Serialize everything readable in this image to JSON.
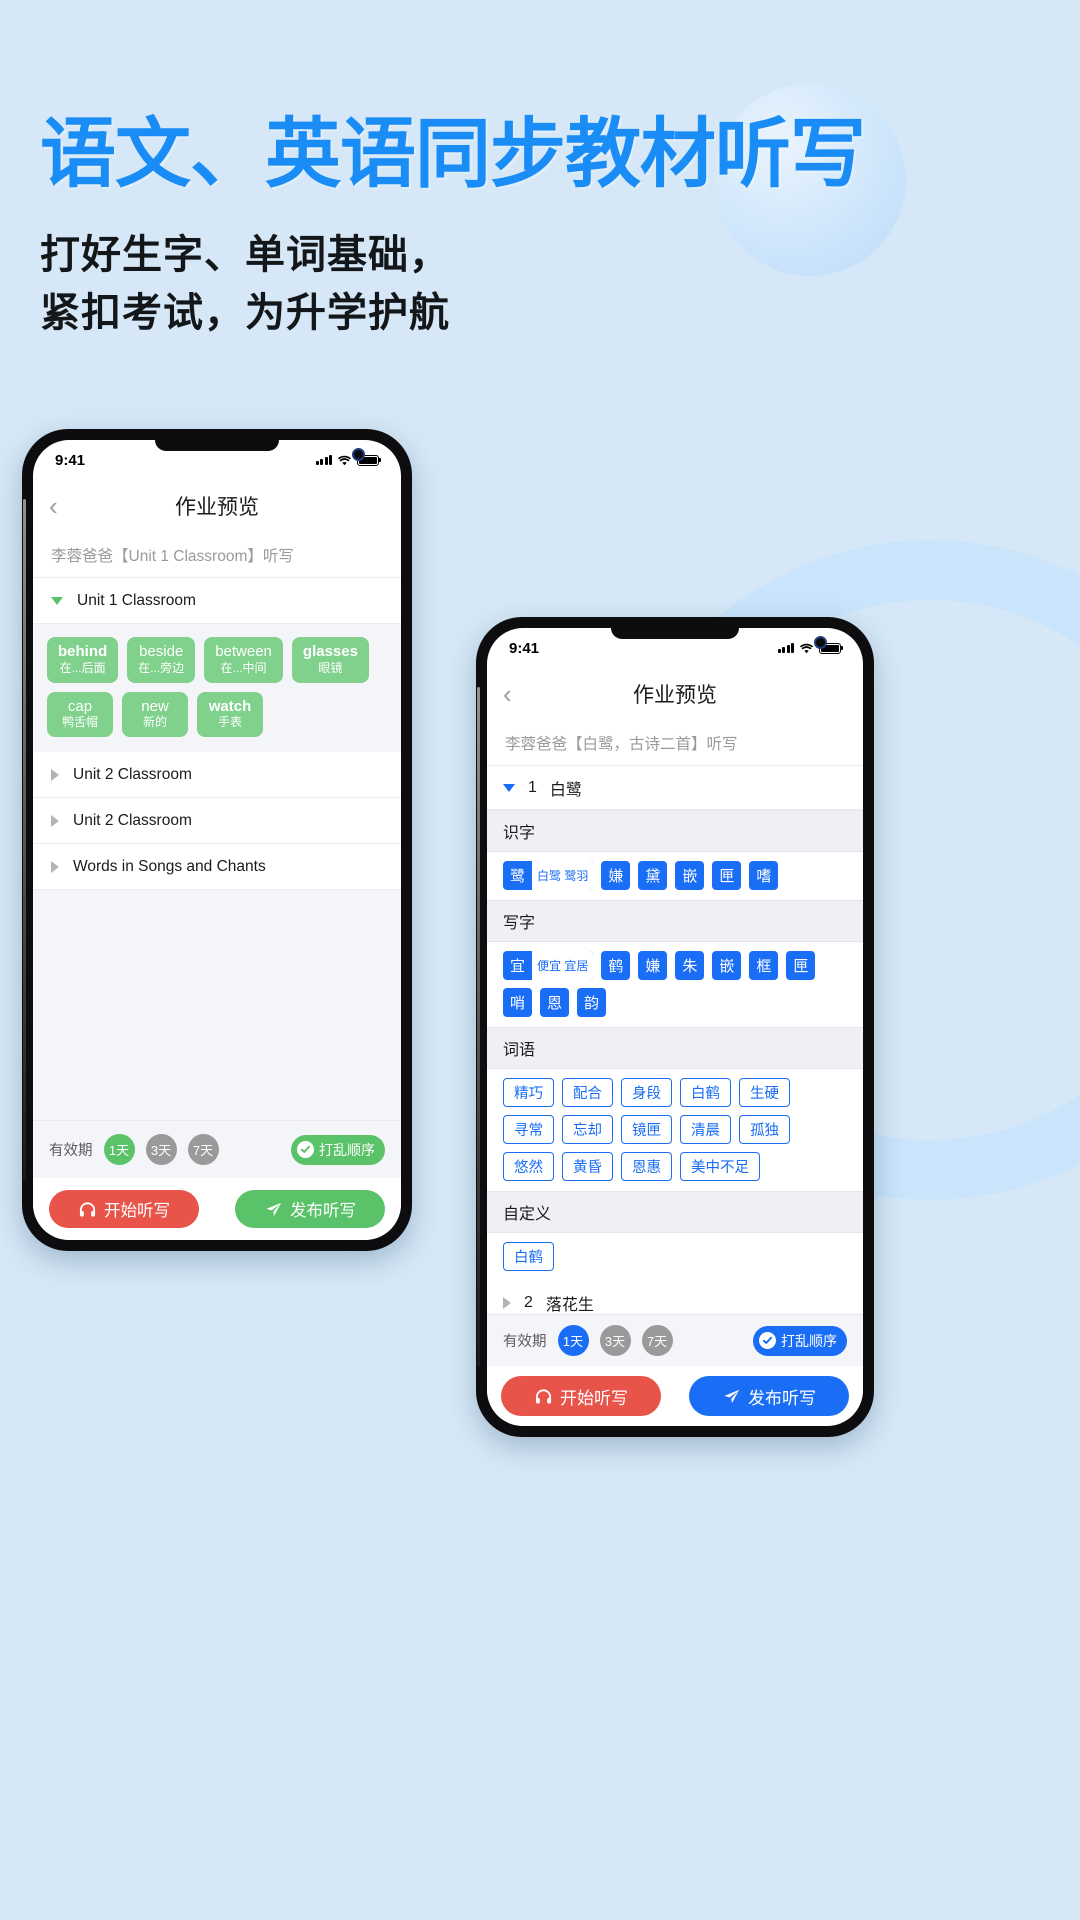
{
  "hero": {
    "title": "语文、英语同步教材听写",
    "subtitle": "打好生字、单词基础，\n紧扣考试，为升学护航",
    "title_color": "#1a8cf5",
    "background_color": "#d6e8f7"
  },
  "phone_left": {
    "status": {
      "time": "9:41",
      "signal_icon": "cellular-bars-icon",
      "wifi_icon": "wifi-icon",
      "battery_icon": "battery-full-icon"
    },
    "nav": {
      "back_icon": "chevron-left-icon",
      "title": "作业预览"
    },
    "subtitle": "李蓉爸爸【Unit 1 Classroom】听写",
    "lessons": [
      {
        "label": "Unit 1 Classroom",
        "expanded": true
      },
      {
        "label": "Unit 2 Classroom",
        "expanded": false
      },
      {
        "label": "Unit 2 Classroom",
        "expanded": false
      },
      {
        "label": "Words in Songs and Chants",
        "expanded": false
      }
    ],
    "words": [
      {
        "en": "behind",
        "cn": "在...后面",
        "bold": true
      },
      {
        "en": "beside",
        "cn": "在...旁边",
        "bold": false
      },
      {
        "en": "between",
        "cn": "在...中间",
        "bold": false
      },
      {
        "en": "glasses",
        "cn": "眼镜",
        "bold": true
      },
      {
        "en": "cap",
        "cn": "鸭舌帽",
        "bold": false
      },
      {
        "en": "new",
        "cn": "新的",
        "bold": false
      },
      {
        "en": "watch",
        "cn": "手表",
        "bold": true
      }
    ],
    "validity": {
      "label": "有效期",
      "options": [
        {
          "text": "1天",
          "selected": true
        },
        {
          "text": "3天",
          "selected": false
        },
        {
          "text": "7天",
          "selected": false
        }
      ],
      "shuffle": {
        "label": "打乱顺序",
        "icon": "check-circle-icon",
        "active": true
      }
    },
    "actions": {
      "start": {
        "label": "开始听写",
        "icon": "headset-icon",
        "color": "#e8534a"
      },
      "publish": {
        "label": "发布听写",
        "icon": "send-icon",
        "color": "#5ac268"
      }
    },
    "accent_color": "#5ac268"
  },
  "phone_right": {
    "status": {
      "time": "9:41",
      "signal_icon": "cellular-bars-icon",
      "wifi_icon": "wifi-icon",
      "battery_icon": "battery-full-icon"
    },
    "nav": {
      "back_icon": "chevron-left-icon",
      "title": "作业预览"
    },
    "subtitle": "李蓉爸爸【白鹭，古诗二首】听写",
    "lesson_open": {
      "number": "1",
      "title": "白鹭",
      "expanded": true
    },
    "lesson_closed": {
      "number": "2",
      "title": "落花生",
      "expanded": false
    },
    "sections": [
      {
        "heading": "识字",
        "type": "chars",
        "items": [
          {
            "char": "鹭",
            "words": "白鹭 鹭羽"
          },
          {
            "char": "嫌"
          },
          {
            "char": "黛"
          },
          {
            "char": "嵌"
          },
          {
            "char": "匣"
          },
          {
            "char": "嗜"
          }
        ]
      },
      {
        "heading": "写字",
        "type": "chars",
        "items": [
          {
            "char": "宜",
            "words": "便宜 宜居"
          },
          {
            "char": "鹤"
          },
          {
            "char": "嫌"
          },
          {
            "char": "朱"
          },
          {
            "char": "嵌"
          },
          {
            "char": "框"
          },
          {
            "char": "匣"
          },
          {
            "char": "哨"
          },
          {
            "char": "恩"
          },
          {
            "char": "韵"
          }
        ]
      },
      {
        "heading": "词语",
        "type": "words",
        "items": [
          "精巧",
          "配合",
          "身段",
          "白鹤",
          "生硬",
          "寻常",
          "忘却",
          "镜匣",
          "清晨",
          "孤独",
          "悠然",
          "黄昏",
          "恩惠",
          "美中不足"
        ]
      },
      {
        "heading": "自定义",
        "type": "words",
        "items": [
          "白鹤"
        ]
      }
    ],
    "validity": {
      "label": "有效期",
      "options": [
        {
          "text": "1天",
          "selected": true
        },
        {
          "text": "3天",
          "selected": false
        },
        {
          "text": "7天",
          "selected": false
        }
      ],
      "shuffle": {
        "label": "打乱顺序",
        "icon": "check-circle-icon",
        "active": true
      }
    },
    "actions": {
      "start": {
        "label": "开始听写",
        "icon": "headset-icon",
        "color": "#e8534a"
      },
      "publish": {
        "label": "发布听写",
        "icon": "send-icon",
        "color": "#1a6df5"
      }
    },
    "accent_color": "#1a6df5"
  }
}
